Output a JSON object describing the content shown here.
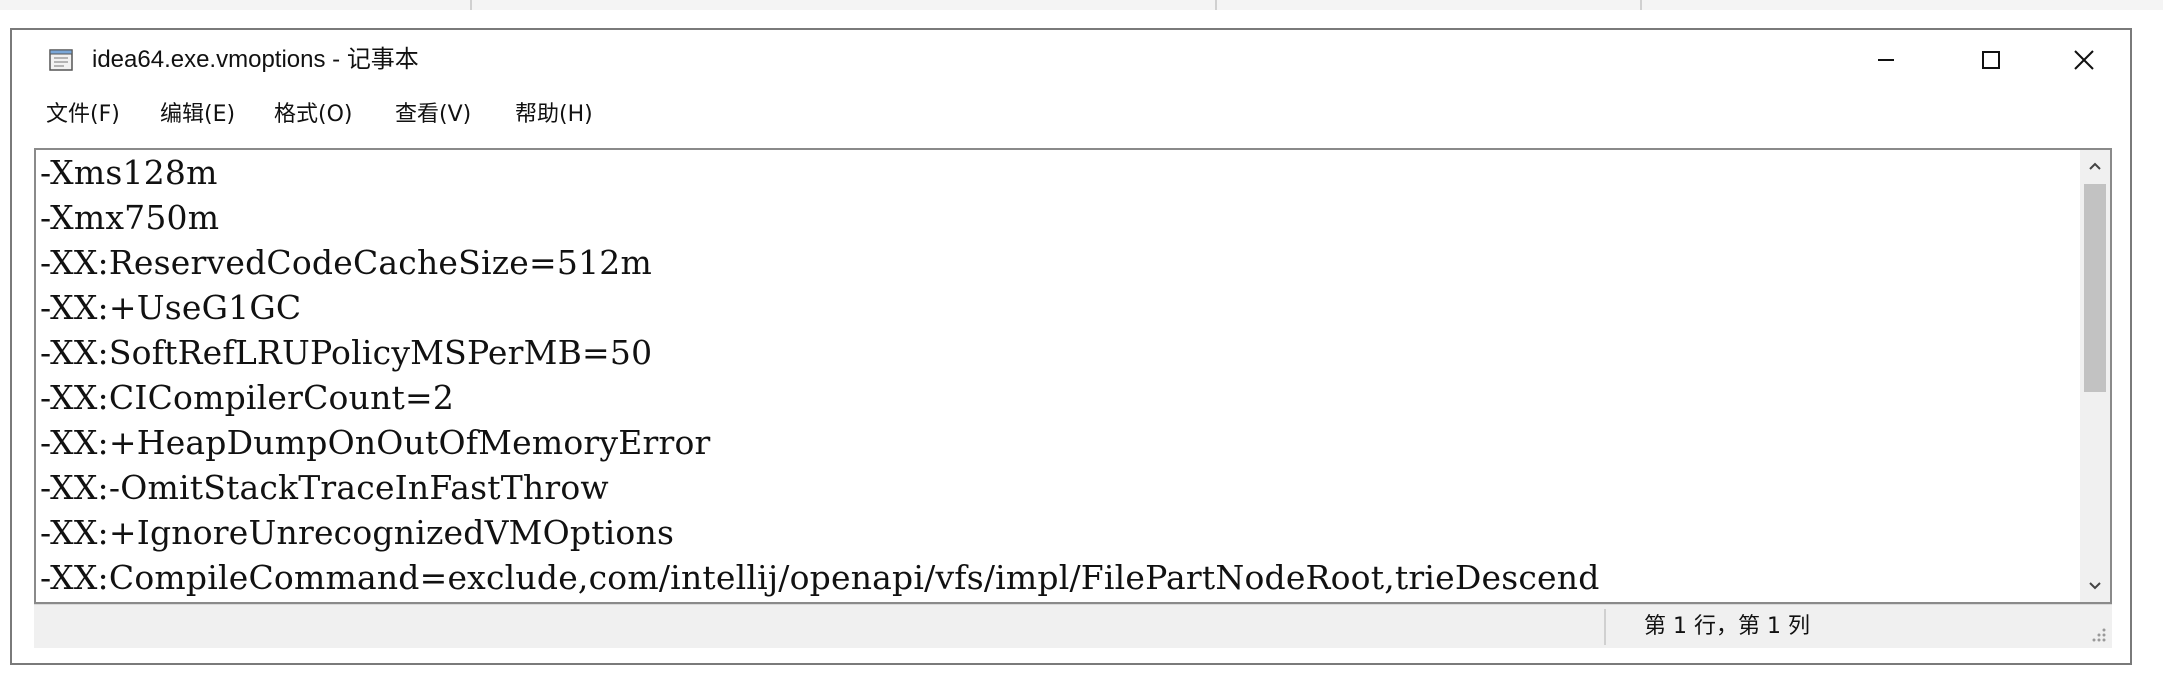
{
  "window": {
    "title": "idea64.exe.vmoptions - 记事本"
  },
  "menu": [
    {
      "label": "文件(F)"
    },
    {
      "label": "编辑(E)"
    },
    {
      "label": "格式(O)"
    },
    {
      "label": "查看(V)"
    },
    {
      "label": "帮助(H)"
    }
  ],
  "editor": {
    "lines": [
      "-Xms128m",
      "-Xmx750m",
      "-XX:ReservedCodeCacheSize=512m",
      "-XX:+UseG1GC",
      "-XX:SoftRefLRUPolicyMSPerMB=50",
      "-XX:CICompilerCount=2",
      "-XX:+HeapDumpOnOutOfMemoryError",
      "-XX:-OmitStackTraceInFastThrow",
      "-XX:+IgnoreUnrecognizedVMOptions",
      "-XX:CompileCommand=exclude,com/intellij/openapi/vfs/impl/FilePartNodeRoot,trieDescend"
    ]
  },
  "statusbar": {
    "position": "第 1 行，第 1 列"
  },
  "icons": {
    "app": "notepad-icon",
    "minimize": "minimize-icon",
    "maximize": "maximize-icon",
    "close": "close-icon"
  }
}
